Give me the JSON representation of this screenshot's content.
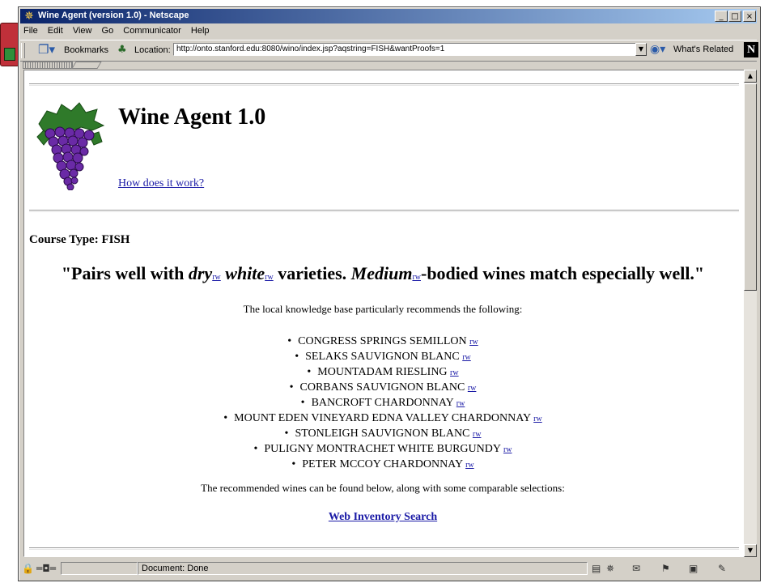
{
  "window": {
    "title": "Wine Agent (version 1.0) - Netscape",
    "buttons": {
      "minimize": "_",
      "maximize": "□",
      "close": "×"
    }
  },
  "menu": [
    "File",
    "Edit",
    "View",
    "Go",
    "Communicator",
    "Help"
  ],
  "toolbar": {
    "bookmarks_label": "Bookmarks",
    "location_label": "Location:",
    "url": "http://onto.stanford.edu:8080/wino/index.jsp?aqstring=FISH&wantProofs=1",
    "related_label": "What's Related"
  },
  "page": {
    "title": "Wine Agent 1.0",
    "how_link": "How does it work?",
    "course": "Course Type: FISH",
    "pairs": {
      "lead": "\"Pairs well with ",
      "w1": "dry",
      "w2": "white",
      "mid": " varieties. ",
      "w3": "Medium",
      "tail": "-bodied wines match especially well.\""
    },
    "rw": "rw",
    "intro": "The local knowledge base particularly recommends the following:",
    "wines": [
      "CONGRESS SPRINGS SEMILLON",
      "SELAKS SAUVIGNON BLANC",
      "MOUNTADAM RIESLING",
      "CORBANS SAUVIGNON BLANC",
      "BANCROFT CHARDONNAY",
      "MOUNT EDEN VINEYARD EDNA VALLEY CHARDONNAY",
      "STONLEIGH SAUVIGNON BLANC",
      "PULIGNY MONTRACHET WHITE BURGUNDY",
      "PETER MCCOY CHARDONNAY"
    ],
    "outro": "The recommended wines can be found below, along with some comparable selections:",
    "search_link": "Web Inventory Search"
  },
  "status": {
    "text": "Document: Done"
  },
  "colors": {
    "link": "#1a1aa6",
    "titlebar_start": "#0a246a",
    "titlebar_end": "#a6caf0",
    "grape": "#6a2aa6"
  }
}
